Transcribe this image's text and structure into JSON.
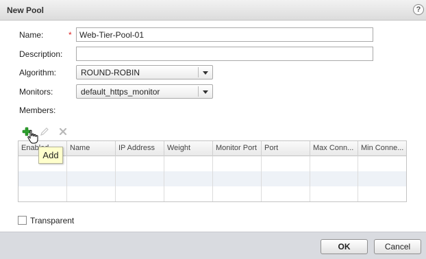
{
  "dialog": {
    "title": "New Pool",
    "help_glyph": "?"
  },
  "form": {
    "name_label": "Name:",
    "required_marker": "*",
    "name_value": "Web-Tier-Pool-01",
    "description_label": "Description:",
    "description_value": "",
    "algorithm_label": "Algorithm:",
    "algorithm_value": "ROUND-ROBIN",
    "monitors_label": "Monitors:",
    "monitors_value": "default_https_monitor",
    "members_label": "Members:"
  },
  "toolbar": {
    "icons": [
      "add-icon",
      "edit-icon",
      "delete-icon"
    ],
    "add_tooltip": "Add"
  },
  "members_table": {
    "columns": [
      "Enabled",
      "Name",
      "IP Address",
      "Weight",
      "Monitor Port",
      "Port",
      "Max Conn...",
      "Min Conne..."
    ],
    "rows": []
  },
  "transparent": {
    "label": "Transparent",
    "checked": false
  },
  "footer": {
    "ok_label": "OK",
    "cancel_label": "Cancel"
  },
  "colors": {
    "add_icon": "#2ea02e",
    "required": "#dd2222",
    "tooltip_bg": "#ffffcc"
  }
}
